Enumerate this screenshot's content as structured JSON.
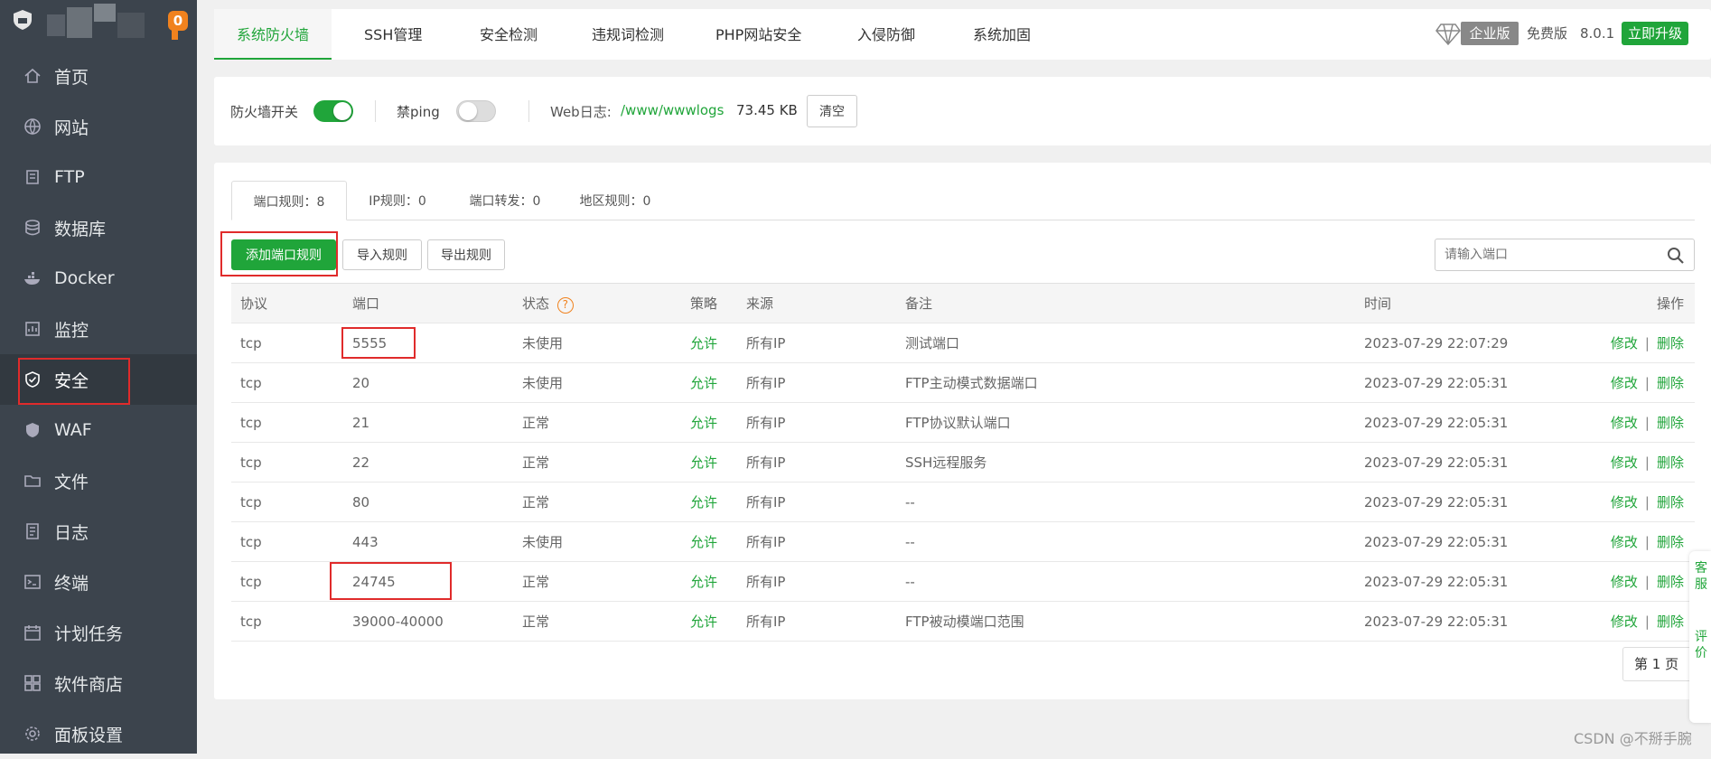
{
  "sidebar": {
    "badge": "0",
    "items": [
      {
        "label": "首页",
        "icon": "home-icon"
      },
      {
        "label": "网站",
        "icon": "globe-icon"
      },
      {
        "label": "FTP",
        "icon": "ftp-icon"
      },
      {
        "label": "数据库",
        "icon": "database-icon"
      },
      {
        "label": "Docker",
        "icon": "docker-icon"
      },
      {
        "label": "监控",
        "icon": "monitor-icon"
      },
      {
        "label": "安全",
        "icon": "shield-check-icon",
        "active": true
      },
      {
        "label": "WAF",
        "icon": "waf-shield-icon"
      },
      {
        "label": "文件",
        "icon": "folder-icon"
      },
      {
        "label": "日志",
        "icon": "log-icon"
      },
      {
        "label": "终端",
        "icon": "terminal-icon"
      },
      {
        "label": "计划任务",
        "icon": "calendar-icon"
      },
      {
        "label": "软件商店",
        "icon": "apps-icon"
      },
      {
        "label": "面板设置",
        "icon": "gear-icon"
      }
    ]
  },
  "topbar": {
    "tabs": [
      "系统防火墙",
      "SSH管理",
      "安全检测",
      "违规词检测",
      "PHP网站安全",
      "入侵防御",
      "系统加固"
    ],
    "enterprise": "企业版",
    "free": "免费版",
    "version": "8.0.1",
    "upgrade": "立即升级"
  },
  "firewall": {
    "switch_label": "防火墙开关",
    "switch_on": true,
    "ping_label": "禁ping",
    "ping_on": false,
    "weblog_label": "Web日志:",
    "weblog_path": "/www/wwwlogs",
    "weblog_size": "73.45 KB",
    "clear_label": "清空"
  },
  "rules": {
    "tabs": [
      "端口规则：8",
      "IP规则：0",
      "端口转发：0",
      "地区规则：0"
    ],
    "add_label": "添加端口规则",
    "import_label": "导入规则",
    "export_label": "导出规则",
    "search_placeholder": "请输入端口",
    "columns": {
      "protocol": "协议",
      "port": "端口",
      "status": "状态",
      "strategy": "策略",
      "source": "来源",
      "remark": "备注",
      "time": "时间",
      "ops": "操作"
    },
    "edit_label": "修改",
    "delete_label": "删除",
    "sep": "|",
    "rows": [
      {
        "protocol": "tcp",
        "port": "5555",
        "status": "未使用",
        "strategy": "允许",
        "source": "所有IP",
        "remark": "测试端口",
        "time": "2023-07-29 22:07:29"
      },
      {
        "protocol": "tcp",
        "port": "20",
        "status": "未使用",
        "strategy": "允许",
        "source": "所有IP",
        "remark": "FTP主动模式数据端口",
        "time": "2023-07-29 22:05:31"
      },
      {
        "protocol": "tcp",
        "port": "21",
        "status": "正常",
        "strategy": "允许",
        "source": "所有IP",
        "remark": "FTP协议默认端口",
        "time": "2023-07-29 22:05:31"
      },
      {
        "protocol": "tcp",
        "port": "22",
        "status": "正常",
        "strategy": "允许",
        "source": "所有IP",
        "remark": "SSH远程服务",
        "time": "2023-07-29 22:05:31"
      },
      {
        "protocol": "tcp",
        "port": "80",
        "status": "正常",
        "strategy": "允许",
        "source": "所有IP",
        "remark": "--",
        "time": "2023-07-29 22:05:31"
      },
      {
        "protocol": "tcp",
        "port": "443",
        "status": "未使用",
        "strategy": "允许",
        "source": "所有IP",
        "remark": "--",
        "time": "2023-07-29 22:05:31"
      },
      {
        "protocol": "tcp",
        "port": "24745",
        "status": "正常",
        "strategy": "允许",
        "source": "所有IP",
        "remark": "--",
        "time": "2023-07-29 22:05:31"
      },
      {
        "protocol": "tcp",
        "port": "39000-40000",
        "status": "正常",
        "strategy": "允许",
        "source": "所有IP",
        "remark": "FTP被动模端口范围",
        "time": "2023-07-29 22:05:31"
      }
    ],
    "pager": "第 1 页"
  },
  "float_panel": {
    "text1": "客服",
    "text2": "评价"
  },
  "watermark": "CSDN @不掰手腕"
}
